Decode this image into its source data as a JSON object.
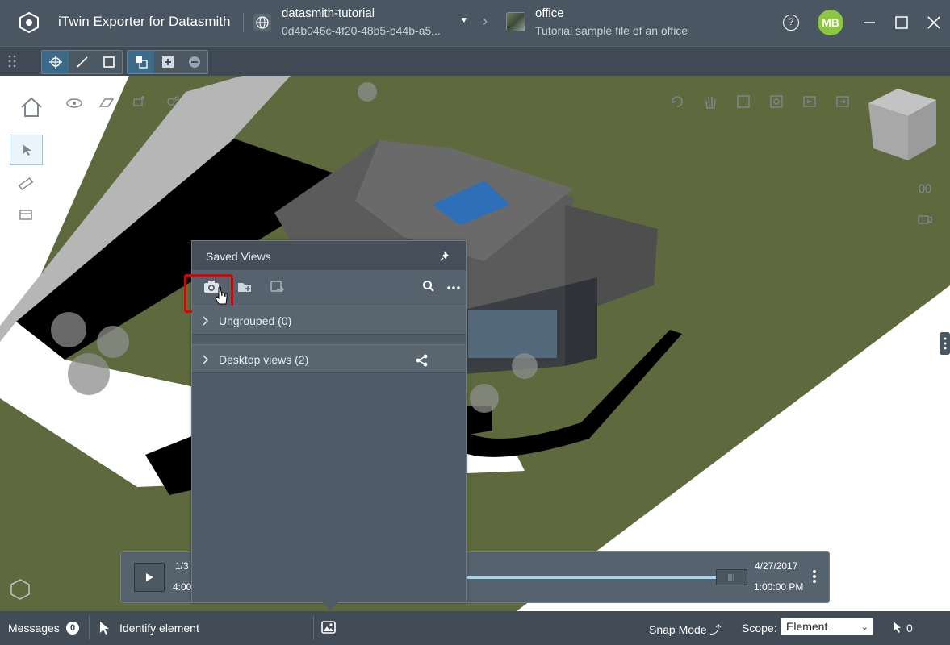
{
  "titlebar": {
    "app_title": "iTwin Exporter for Datasmith",
    "project": {
      "name": "datasmith-tutorial",
      "id": "0d4b046c-4f20-48b5-b44b-a5..."
    },
    "imodel": {
      "name": "office",
      "description": "Tutorial sample file of an office"
    },
    "help_label": "?",
    "user_initials": "MB",
    "avatar_color": "#8cc63f"
  },
  "saved_views": {
    "title": "Saved Views",
    "groups": [
      {
        "label": "Ungrouped (0)"
      },
      {
        "label": "Desktop views (2)"
      }
    ]
  },
  "timeline": {
    "start_date": "1/3",
    "start_time": "4:00",
    "end_date": "4/27/2017",
    "end_time": "1:00:00 PM"
  },
  "statusbar": {
    "messages_label": "Messages",
    "messages_count": "0",
    "tool_prompt": "Identify element",
    "snap_mode_label": "Snap Mode",
    "scope_label": "Scope:",
    "scope_value": "Element",
    "selection_count": "0"
  },
  "colors": {
    "titlebar": "#4a5661",
    "toolbar": "#3f4a54",
    "panel": "#4f5b66",
    "highlight": "#e00000",
    "grass": "#5e6a3e",
    "accent": "#3b6a8a"
  }
}
